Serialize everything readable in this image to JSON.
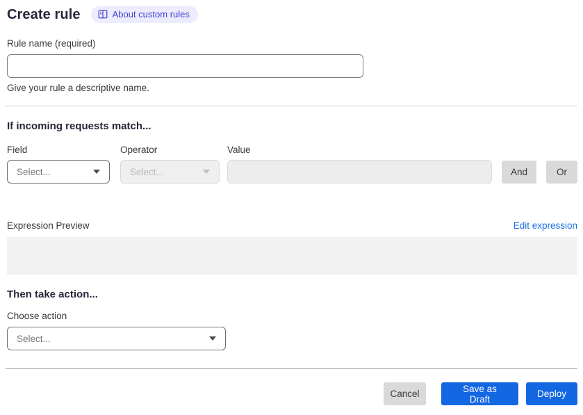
{
  "page": {
    "title": "Create rule",
    "about_badge_label": "About custom rules"
  },
  "rule_name": {
    "label": "Rule name (required)",
    "value": "",
    "help": "Give your rule a descriptive name."
  },
  "match_section": {
    "heading": "If incoming requests match...",
    "field": {
      "label": "Field",
      "selected": "Select..."
    },
    "operator": {
      "label": "Operator",
      "selected": "Select...",
      "disabled": true
    },
    "value": {
      "label": "Value",
      "value": "",
      "disabled": true
    },
    "and_button": "And",
    "or_button": "Or",
    "expression_preview_label": "Expression Preview",
    "edit_expression_link": "Edit expression",
    "expression_value": ""
  },
  "action_section": {
    "heading": "Then take action...",
    "choose_label": "Choose action",
    "selected": "Select..."
  },
  "footer": {
    "cancel": "Cancel",
    "save_draft": "Save as Draft",
    "deploy": "Deploy"
  },
  "colors": {
    "primary_blue": "#1467e2",
    "link_blue": "#1a6ee8",
    "badge_bg": "#edecfc",
    "badge_text": "#3f3fd0",
    "disabled_bg": "#efefef",
    "gray_button_bg": "#d9d9d9",
    "preview_bg": "#f2f2f2"
  }
}
